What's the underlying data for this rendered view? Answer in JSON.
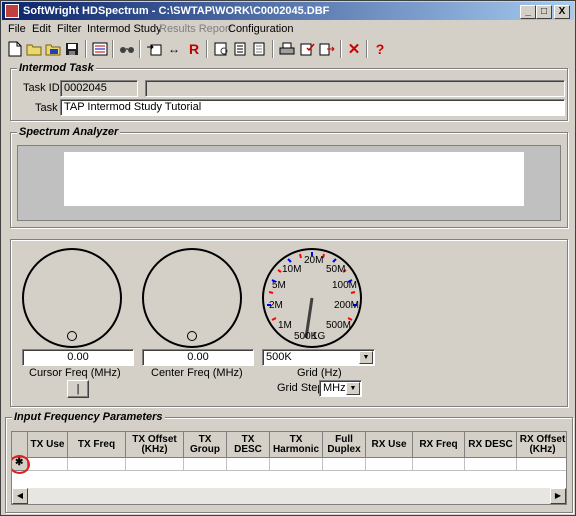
{
  "window": {
    "title": "SoftWright HDSpectrum - C:\\SWTAP\\WORK\\C0002045.DBF",
    "minimize_glyph": "_",
    "maximize_glyph": "□",
    "close_glyph": "X"
  },
  "menu": [
    {
      "label": "File",
      "enabled": true
    },
    {
      "label": "Edit",
      "enabled": true
    },
    {
      "label": "Filter",
      "enabled": true
    },
    {
      "label": "Intermod Study",
      "enabled": true
    },
    {
      "label": "Results Report",
      "enabled": false
    },
    {
      "label": "Configuration",
      "enabled": true
    }
  ],
  "toolbar": {
    "icons": [
      "new-file-icon",
      "open-folder-icon",
      "open-db-icon",
      "save-icon",
      "list-icon",
      "glasses-icon",
      "import-icon",
      "swap-arrows-icon",
      "r-icon",
      "print-preview-icon",
      "report-icon",
      "report-alt-icon",
      "printer-icon",
      "check-doc-icon",
      "export-icon",
      "delete-x-icon",
      "help-icon"
    ],
    "glyphs": {
      "swap": "↔",
      "r": "R",
      "x": "✕",
      "help": "?"
    }
  },
  "intermod_task": {
    "title": "Intermod Task",
    "task_id_label": "Task ID:",
    "task_id_value": "0002045",
    "task_label": "Task",
    "task_value": "TAP Intermod Study Tutorial"
  },
  "spectrum_analyzer": {
    "title": "Spectrum Analyzer"
  },
  "controls": {
    "cursor_freq_value": "0.00",
    "cursor_freq_label": "Cursor Freq (MHz)",
    "cursor_button_label": "|",
    "center_freq_value": "0.00",
    "center_freq_label": "Center Freq (MHz)",
    "grid_value": "500K",
    "grid_label": "Grid (Hz)",
    "grid_step_label": "Grid Step",
    "grid_step_value": "MHz",
    "dial_labels": [
      "10M",
      "20M",
      "50M",
      "5M",
      "100M",
      "2M",
      "200M",
      "1M",
      "500M",
      "500K",
      "1G"
    ]
  },
  "input_freq": {
    "title": "Input Frequency Parameters",
    "columns": [
      {
        "label": "TX Use"
      },
      {
        "label": "TX Freq"
      },
      {
        "label": "TX Offset (KHz)"
      },
      {
        "label": "TX Group"
      },
      {
        "label": "TX DESC"
      },
      {
        "label": "TX Harmonic"
      },
      {
        "label": "Full Duplex"
      },
      {
        "label": "RX Use"
      },
      {
        "label": "RX Freq"
      },
      {
        "label": "RX DESC"
      },
      {
        "label": "RX Offset (KHz)"
      }
    ],
    "new_row_marker": "✱",
    "scroll_left": "◀",
    "scroll_right": "▶"
  }
}
